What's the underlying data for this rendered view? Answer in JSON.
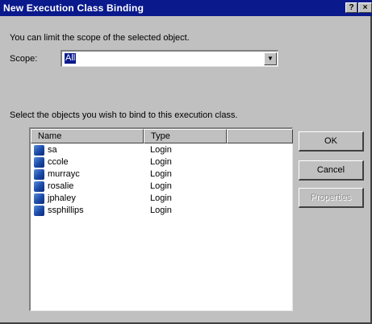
{
  "window": {
    "title": "New Execution Class Binding",
    "help_label": "?",
    "close_label": "×"
  },
  "intro_text": "You can limit the scope of the selected object.",
  "scope": {
    "label": "Scope:",
    "value": "All"
  },
  "select_label": "Select the objects you wish to bind to this execution class.",
  "list": {
    "columns": [
      "Name",
      "Type",
      ""
    ],
    "rows": [
      {
        "name": "sa",
        "type": "Login"
      },
      {
        "name": "ccole",
        "type": "Login"
      },
      {
        "name": "murrayc",
        "type": "Login"
      },
      {
        "name": "rosalie",
        "type": "Login"
      },
      {
        "name": "jphaley",
        "type": "Login"
      },
      {
        "name": "ssphillips",
        "type": "Login"
      }
    ]
  },
  "buttons": {
    "ok": "OK",
    "cancel": "Cancel",
    "properties": "Properties"
  }
}
